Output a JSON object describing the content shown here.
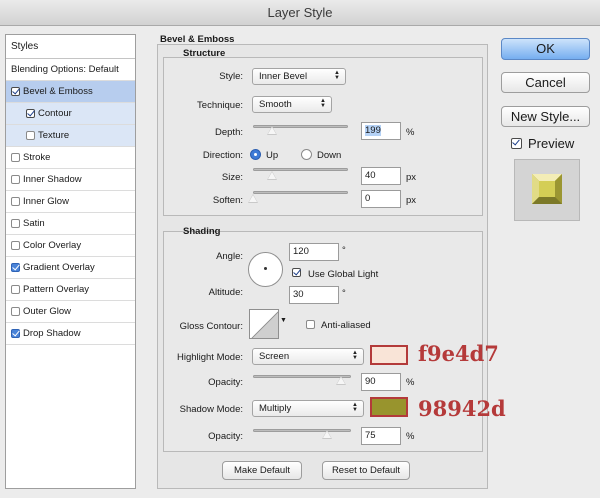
{
  "window": {
    "title": "Layer Style"
  },
  "styles_panel": {
    "header": "Styles",
    "items": [
      {
        "label": "Blending Options: Default",
        "checkbox": false,
        "checked": false
      },
      {
        "label": "Bevel & Emboss",
        "checkbox": true,
        "checked": true
      },
      {
        "label": "Contour",
        "checkbox": true,
        "checked": true
      },
      {
        "label": "Texture",
        "checkbox": true,
        "checked": false
      },
      {
        "label": "Stroke",
        "checkbox": true,
        "checked": false
      },
      {
        "label": "Inner Shadow",
        "checkbox": true,
        "checked": false
      },
      {
        "label": "Inner Glow",
        "checkbox": true,
        "checked": false
      },
      {
        "label": "Satin",
        "checkbox": true,
        "checked": false
      },
      {
        "label": "Color Overlay",
        "checkbox": true,
        "checked": false
      },
      {
        "label": "Gradient Overlay",
        "checkbox": true,
        "checked": true
      },
      {
        "label": "Pattern Overlay",
        "checkbox": true,
        "checked": false
      },
      {
        "label": "Outer Glow",
        "checkbox": true,
        "checked": false
      },
      {
        "label": "Drop Shadow",
        "checkbox": true,
        "checked": true
      }
    ]
  },
  "bevel": {
    "title": "Bevel & Emboss",
    "structure": {
      "title": "Structure",
      "style_label": "Style:",
      "style_value": "Inner Bevel",
      "technique_label": "Technique:",
      "technique_value": "Smooth",
      "depth_label": "Depth:",
      "depth_value": "199",
      "depth_unit": "%",
      "depth_level": 0.2,
      "direction_label": "Direction:",
      "direction_up": "Up",
      "direction_down": "Down",
      "direction_selected": "Up",
      "size_label": "Size:",
      "size_value": "40",
      "size_unit": "px",
      "size_level": 0.2,
      "soften_label": "Soften:",
      "soften_value": "0",
      "soften_unit": "px",
      "soften_level": 0.0
    },
    "shading": {
      "title": "Shading",
      "angle_label": "Angle:",
      "angle_value": "120",
      "angle_unit": "°",
      "use_global_light_label": "Use Global Light",
      "use_global_light": true,
      "altitude_label": "Altitude:",
      "altitude_value": "30",
      "altitude_unit": "°",
      "gloss_contour_label": "Gloss Contour:",
      "anti_aliased_label": "Anti-aliased",
      "anti_aliased": false,
      "highlight_mode_label": "Highlight Mode:",
      "highlight_mode_value": "Screen",
      "highlight_opacity_label": "Opacity:",
      "highlight_opacity_value": "90",
      "highlight_opacity_unit": "%",
      "highlight_opacity_level": 0.9,
      "highlight_color": "#f9e4d7",
      "highlight_hex_note": "f9e4d7",
      "shadow_mode_label": "Shadow Mode:",
      "shadow_mode_value": "Multiply",
      "shadow_opacity_label": "Opacity:",
      "shadow_opacity_value": "75",
      "shadow_opacity_unit": "%",
      "shadow_opacity_level": 0.75,
      "shadow_color": "#98942d",
      "shadow_hex_note": "98942d"
    },
    "make_default_label": "Make Default",
    "reset_default_label": "Reset to Default"
  },
  "actions": {
    "ok_label": "OK",
    "cancel_label": "Cancel",
    "new_style_label": "New Style...",
    "preview_label": "Preview",
    "preview_checked": true
  }
}
